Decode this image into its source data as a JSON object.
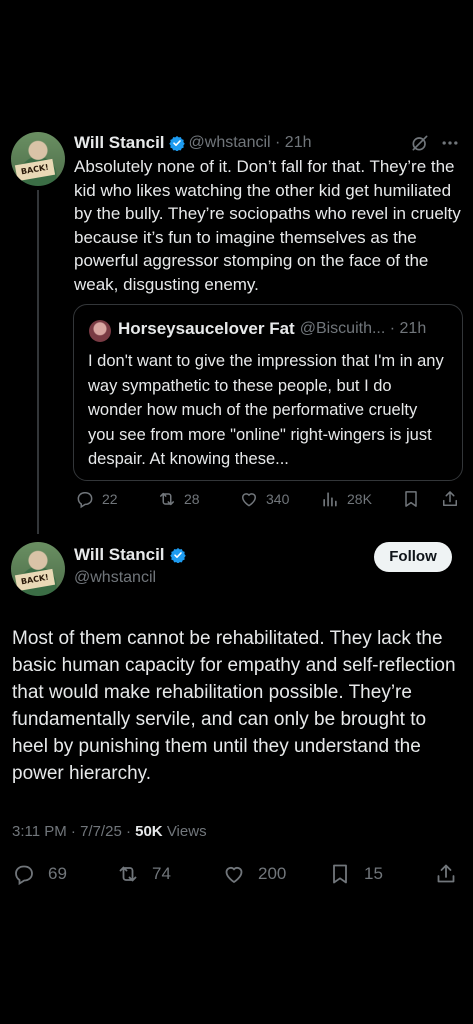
{
  "reply_tweet": {
    "author_name": "Will Stancil",
    "handle_time": "@whstancil · 21h",
    "avatar_sign": "BACK!",
    "text": "Absolutely none of it. Don’t fall for that. They’re the kid who likes watching the other kid get humiliated by the bully. They’re sociopaths who revel in cruelty because it’s fun to imagine themselves as the powerful aggressor stomping on the face of the weak, disgusting enemy.",
    "quote": {
      "author_name": "Horseysaucelover Fat",
      "handle_time": "@Biscuith... · 21h",
      "text": "I don't want to give the impression that I'm in any way sympathetic to these people, but I do wonder how much of the performative cruelty you see from more \"online\" right-wingers is just despair.  At knowing these..."
    },
    "actions": {
      "replies": "22",
      "reposts": "28",
      "likes": "340",
      "views": "28K"
    }
  },
  "main_tweet": {
    "author_name": "Will Stancil",
    "handle": "@whstancil",
    "avatar_sign": "BACK!",
    "follow_label": "Follow",
    "text": "Most of them cannot be rehabilitated. They lack the basic human capacity for empathy and self-reflection that would make rehabilitation possible. They’re fundamentally servile, and can only be brought to heel by punishing them until they understand the power hierarchy.",
    "timestamp": "3:11 PM · 7/7/25 · ",
    "view_count": "50K",
    "views_label": " Views",
    "actions": {
      "replies": "69",
      "reposts": "74",
      "likes": "200",
      "bookmarks": "15"
    }
  },
  "colors": {
    "background": "#000000",
    "text": "#e7e9ea",
    "muted": "#71767b",
    "verified": "#1d9bf0"
  },
  "icons": [
    "grok-icon",
    "more-icon",
    "verified-icon",
    "reply-icon",
    "repost-icon",
    "like-icon",
    "views-icon",
    "bookmark-icon",
    "share-icon"
  ]
}
